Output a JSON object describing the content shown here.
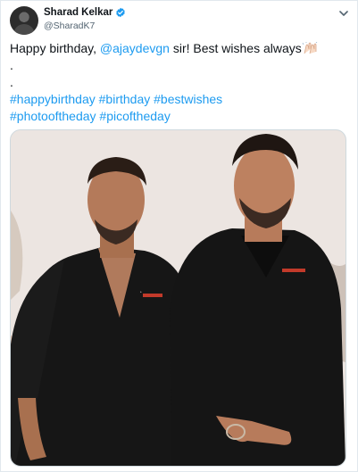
{
  "tweet": {
    "display_name": "Sharad Kelkar",
    "handle": "@SharadK7",
    "text": {
      "line1_prefix": "Happy birthday, ",
      "mention": "@ajaydevgn",
      "line1_suffix": " sir! Best wishes always",
      "dot1": ".",
      "dot2": ".",
      "hashtags_line1": [
        "#happybirthday",
        "#birthday",
        "#bestwishes"
      ],
      "hashtags_line2": [
        "#photooftheday",
        "#picoftheday"
      ]
    },
    "icons": {
      "verified": "verified-badge-icon",
      "more": "chevron-down-icon",
      "emoji": "clapping-hands-emoji"
    },
    "colors": {
      "accent": "#1d9bf0",
      "text": "#0f1419",
      "secondary": "#536471"
    }
  }
}
